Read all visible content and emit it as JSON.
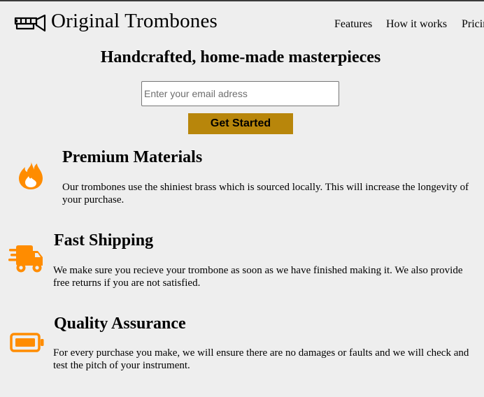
{
  "header": {
    "brand": "Original Trombones",
    "nav": [
      "Features",
      "How it works",
      "Pricing"
    ]
  },
  "hero": {
    "title": "Handcrafted, home-made masterpieces",
    "email_placeholder": "Enter your email adress",
    "email_value": "",
    "cta_label": "Get Started"
  },
  "features": [
    {
      "icon": "fire-icon",
      "title": "Premium Materials",
      "text": "Our trombones use the shiniest brass which is sourced locally. This will increase the longevity of your purchase."
    },
    {
      "icon": "shipping-truck-icon",
      "title": "Fast Shipping",
      "text": "We make sure you recieve your trombone as soon as we have finished making it. We also provide free returns if you are not satisfied."
    },
    {
      "icon": "battery-icon",
      "title": "Quality Assurance",
      "text": "For every purchase you make, we will ensure there are no damages or faults and we will check and test the pitch of your instrument."
    }
  ],
  "colors": {
    "accent": "#b8860b",
    "icon": "#ff8c00",
    "background": "#eeeeee"
  }
}
